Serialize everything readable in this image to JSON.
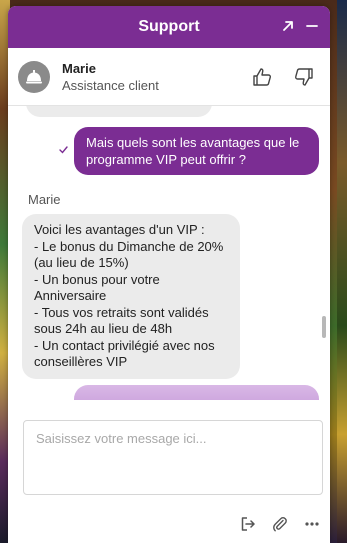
{
  "window": {
    "title": "Support",
    "expand_icon": "arrow-up-right-icon",
    "minimize_icon": "minimize-icon"
  },
  "agent": {
    "name": "Marie",
    "role": "Assistance client",
    "avatar_icon": "service-bell-icon",
    "thumbs_up_icon": "thumbs-up-icon",
    "thumbs_down_icon": "thumbs-down-icon"
  },
  "messages": [
    {
      "from": "user",
      "text": "Mais quels sont les avantages que le programme VIP peut offrir ?",
      "status_icon": "check-icon"
    },
    {
      "from": "agent",
      "sender": "Marie",
      "text": "Voici les avantages d'un VIP :\n- Le bonus du Dimanche de 20% (au lieu de 15%)\n- Un bonus pour votre Anniversaire\n- Tous vos retraits sont validés sous 24h au lieu de 48h\n- Un contact privilégié avec nos conseillères VIP"
    }
  ],
  "composer": {
    "placeholder": "Saisissez votre message ici..."
  },
  "toolbar": {
    "icons": [
      "exit-chat-icon",
      "paperclip-icon",
      "more-options-icon"
    ]
  },
  "colors": {
    "brand": "#7b2d93",
    "agent_bubble": "#ebebeb"
  }
}
